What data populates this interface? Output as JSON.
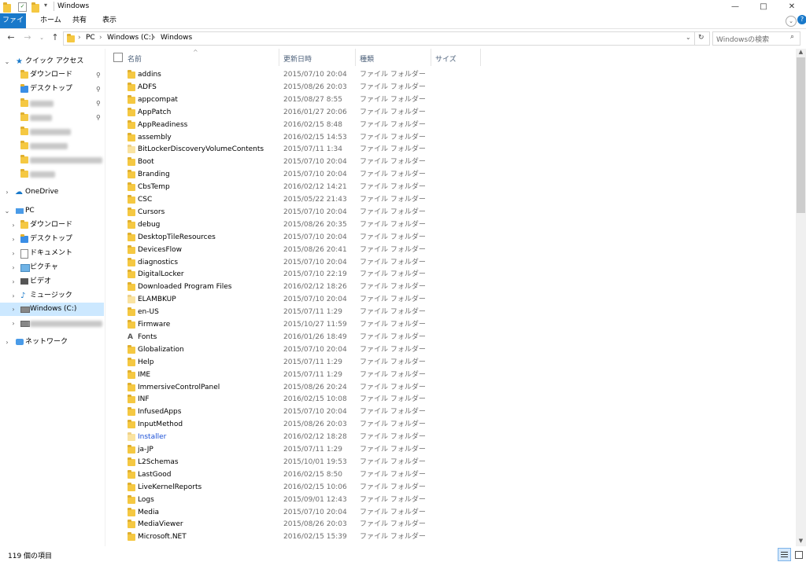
{
  "window": {
    "title": "Windows",
    "controls": [
      "—",
      "□",
      "✕"
    ]
  },
  "ribbon": {
    "tabs": [
      "ファイル",
      "ホーム",
      "共有",
      "表示"
    ]
  },
  "address": {
    "crumbs": [
      "PC",
      "Windows (C:)",
      "Windows"
    ],
    "search_placeholder": "Windowsの検索"
  },
  "nav": {
    "quick_access": "クイック アクセス",
    "qa_items": [
      "ダウンロード",
      "デスクトップ"
    ],
    "onedrive": "OneDrive",
    "pc": "PC",
    "pc_items": [
      "ダウンロード",
      "デスクトップ",
      "ドキュメント",
      "ピクチャ",
      "ビデオ",
      "ミュージック",
      "Windows (C:)"
    ],
    "network": "ネットワーク"
  },
  "columns": {
    "name": "名前",
    "date": "更新日時",
    "type": "種類",
    "size": "サイズ"
  },
  "files": [
    {
      "name": "addins",
      "date": "2015/07/10 20:04",
      "type": "ファイル フォルダー"
    },
    {
      "name": "ADFS",
      "date": "2015/08/26 20:03",
      "type": "ファイル フォルダー"
    },
    {
      "name": "appcompat",
      "date": "2015/08/27 8:55",
      "type": "ファイル フォルダー"
    },
    {
      "name": "AppPatch",
      "date": "2016/01/27 20:06",
      "type": "ファイル フォルダー"
    },
    {
      "name": "AppReadiness",
      "date": "2016/02/15 8:48",
      "type": "ファイル フォルダー"
    },
    {
      "name": "assembly",
      "date": "2016/02/15 14:53",
      "type": "ファイル フォルダー"
    },
    {
      "name": "BitLockerDiscoveryVolumeContents",
      "date": "2015/07/11 1:34",
      "type": "ファイル フォルダー"
    },
    {
      "name": "Boot",
      "date": "2015/07/10 20:04",
      "type": "ファイル フォルダー"
    },
    {
      "name": "Branding",
      "date": "2015/07/10 20:04",
      "type": "ファイル フォルダー"
    },
    {
      "name": "CbsTemp",
      "date": "2016/02/12 14:21",
      "type": "ファイル フォルダー"
    },
    {
      "name": "CSC",
      "date": "2015/05/22 21:43",
      "type": "ファイル フォルダー"
    },
    {
      "name": "Cursors",
      "date": "2015/07/10 20:04",
      "type": "ファイル フォルダー"
    },
    {
      "name": "debug",
      "date": "2015/08/26 20:35",
      "type": "ファイル フォルダー"
    },
    {
      "name": "DesktopTileResources",
      "date": "2015/07/10 20:04",
      "type": "ファイル フォルダー"
    },
    {
      "name": "DevicesFlow",
      "date": "2015/08/26 20:41",
      "type": "ファイル フォルダー"
    },
    {
      "name": "diagnostics",
      "date": "2015/07/10 20:04",
      "type": "ファイル フォルダー"
    },
    {
      "name": "DigitalLocker",
      "date": "2015/07/10 22:19",
      "type": "ファイル フォルダー"
    },
    {
      "name": "Downloaded Program Files",
      "date": "2016/02/12 18:26",
      "type": "ファイル フォルダー"
    },
    {
      "name": "ELAMBKUP",
      "date": "2015/07/10 20:04",
      "type": "ファイル フォルダー"
    },
    {
      "name": "en-US",
      "date": "2015/07/11 1:29",
      "type": "ファイル フォルダー"
    },
    {
      "name": "Firmware",
      "date": "2015/10/27 11:59",
      "type": "ファイル フォルダー"
    },
    {
      "name": "Fonts",
      "date": "2016/01/26 18:49",
      "type": "ファイル フォルダー"
    },
    {
      "name": "Globalization",
      "date": "2015/07/10 20:04",
      "type": "ファイル フォルダー"
    },
    {
      "name": "Help",
      "date": "2015/07/11 1:29",
      "type": "ファイル フォルダー"
    },
    {
      "name": "IME",
      "date": "2015/07/11 1:29",
      "type": "ファイル フォルダー"
    },
    {
      "name": "ImmersiveControlPanel",
      "date": "2015/08/26 20:24",
      "type": "ファイル フォルダー"
    },
    {
      "name": "INF",
      "date": "2016/02/15 10:08",
      "type": "ファイル フォルダー"
    },
    {
      "name": "InfusedApps",
      "date": "2015/07/10 20:04",
      "type": "ファイル フォルダー"
    },
    {
      "name": "InputMethod",
      "date": "2015/08/26 20:03",
      "type": "ファイル フォルダー"
    },
    {
      "name": "Installer",
      "date": "2016/02/12 18:28",
      "type": "ファイル フォルダー"
    },
    {
      "name": "ja-JP",
      "date": "2015/07/11 1:29",
      "type": "ファイル フォルダー"
    },
    {
      "name": "L2Schemas",
      "date": "2015/10/01 19:53",
      "type": "ファイル フォルダー"
    },
    {
      "name": "LastGood",
      "date": "2016/02/15 8:50",
      "type": "ファイル フォルダー"
    },
    {
      "name": "LiveKernelReports",
      "date": "2016/02/15 10:06",
      "type": "ファイル フォルダー"
    },
    {
      "name": "Logs",
      "date": "2015/09/01 12:43",
      "type": "ファイル フォルダー"
    },
    {
      "name": "Media",
      "date": "2015/07/10 20:04",
      "type": "ファイル フォルダー"
    },
    {
      "name": "MediaViewer",
      "date": "2015/08/26 20:03",
      "type": "ファイル フォルダー"
    },
    {
      "name": "Microsoft.NET",
      "date": "2016/02/15 15:39",
      "type": "ファイル フォルダー"
    }
  ],
  "status": {
    "count": "119 個の項目"
  },
  "colors": {
    "accent": "#1979ca",
    "selection": "#cce8ff",
    "folder": "#f5c842",
    "hidden_name": "#1a4fd6"
  }
}
